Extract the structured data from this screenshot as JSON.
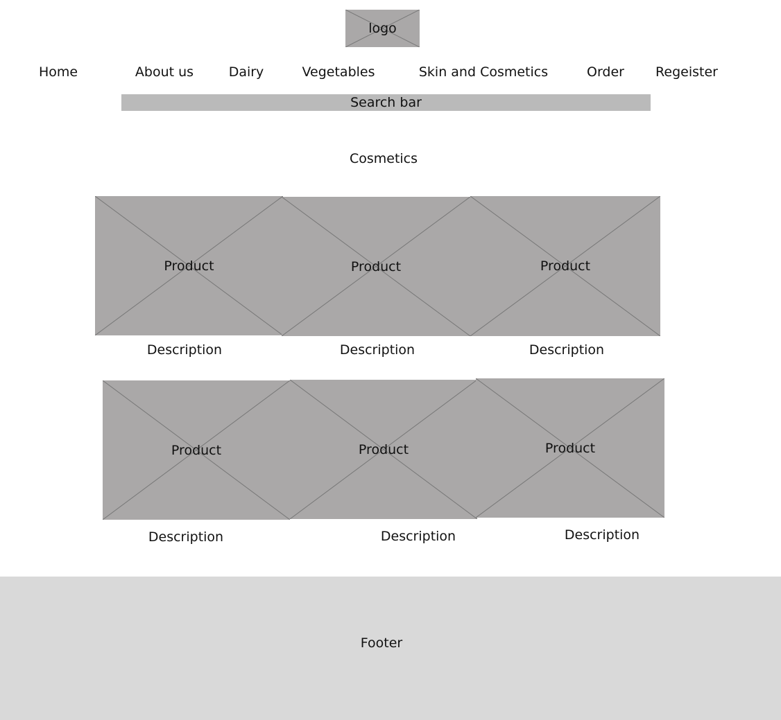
{
  "header": {
    "logo": "logo"
  },
  "nav": [
    {
      "label": "Home"
    },
    {
      "label": "About us"
    },
    {
      "label": "Dairy"
    },
    {
      "label": "Vegetables"
    },
    {
      "label": "Skin and Cosmetics"
    },
    {
      "label": "Order"
    },
    {
      "label": "Regeister"
    }
  ],
  "search": {
    "label": "Search bar"
  },
  "section": {
    "title": "Cosmetics"
  },
  "products": [
    {
      "image": "Product",
      "description": "Description"
    },
    {
      "image": "Product",
      "description": "Description"
    },
    {
      "image": "Product",
      "description": "Description"
    },
    {
      "image": "Product",
      "description": "Description"
    },
    {
      "image": "Product",
      "description": "Description"
    },
    {
      "image": "Product",
      "description": "Description"
    }
  ],
  "footer": {
    "label": "Footer"
  },
  "colors": {
    "placeholder": "#aaa8a8",
    "search": "#bababa",
    "footer": "#d9d9d9"
  }
}
